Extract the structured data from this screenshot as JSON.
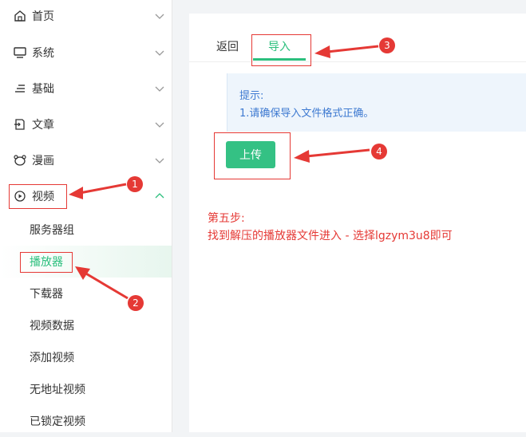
{
  "sidebar": {
    "menu": [
      {
        "label": "首页",
        "icon": "home-icon"
      },
      {
        "label": "系统",
        "icon": "monitor-icon"
      },
      {
        "label": "基础",
        "icon": "list-icon"
      },
      {
        "label": "文章",
        "icon": "article-icon"
      },
      {
        "label": "漫画",
        "icon": "bear-icon"
      },
      {
        "label": "视频",
        "icon": "play-circle-icon"
      }
    ],
    "submenu": [
      {
        "label": "服务器组"
      },
      {
        "label": "播放器"
      },
      {
        "label": "下载器"
      },
      {
        "label": "视频数据"
      },
      {
        "label": "添加视频"
      },
      {
        "label": "无地址视频"
      },
      {
        "label": "已锁定视频"
      }
    ]
  },
  "tabs": [
    {
      "label": "返回"
    },
    {
      "label": "导入"
    }
  ],
  "notice": {
    "title": "提示:",
    "line1": "1.请确保导入文件格式正确。"
  },
  "upload_label": "上传",
  "instruction": {
    "line1": "第五步:",
    "line2": "找到解压的播放器文件进入 -  选择lgzym3u8即可"
  },
  "badges": [
    "1",
    "2",
    "3",
    "4"
  ],
  "colors": {
    "accent": "#2bbf7d",
    "annotation": "#e53935",
    "notice_text": "#3e7ad1"
  }
}
